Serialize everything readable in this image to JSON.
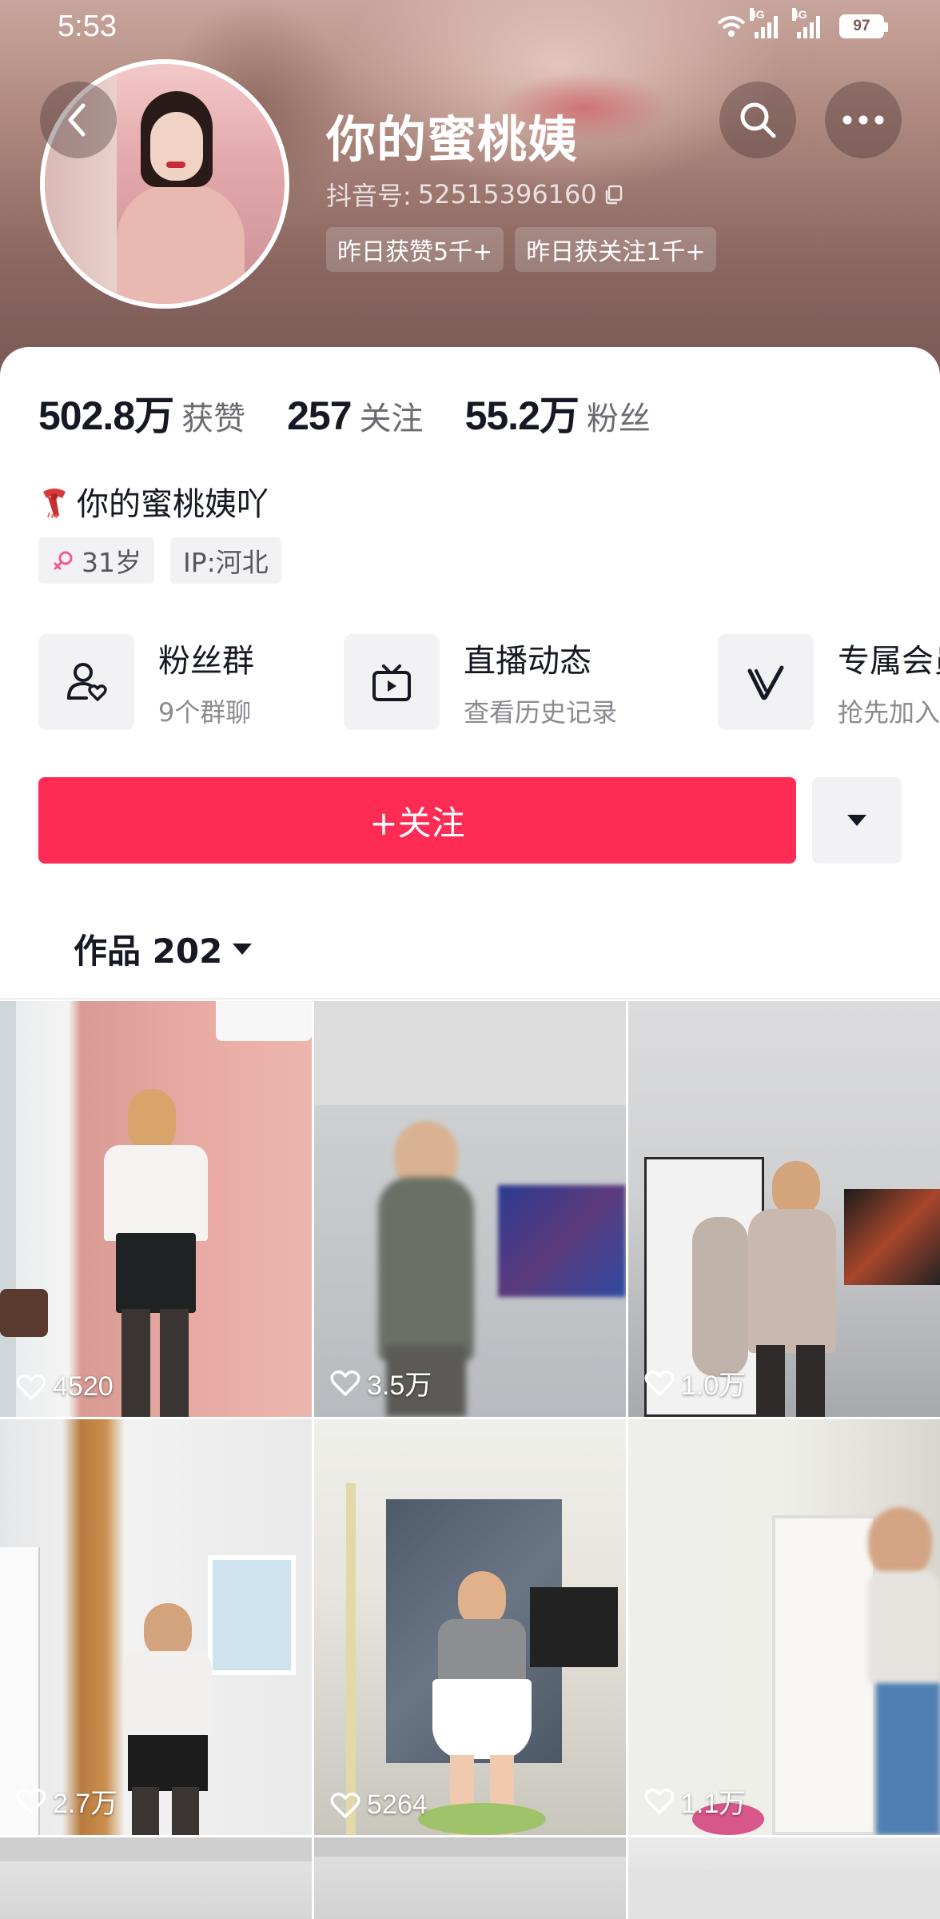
{
  "status_bar": {
    "time": "5:53",
    "battery": "97",
    "network": "4G"
  },
  "header": {
    "name": "你的蜜桃姨",
    "douyin_id_label": "抖音号:",
    "douyin_id": "52515396160",
    "tags": [
      "昨日获赞5千+",
      "昨日获关注1千+"
    ]
  },
  "stats": [
    {
      "value": "502.8万",
      "label": "获赞"
    },
    {
      "value": "257",
      "label": "关注"
    },
    {
      "value": "55.2万",
      "label": "粉丝"
    }
  ],
  "bio": "你的蜜桃姨吖",
  "profile_tags": {
    "age": "31岁",
    "ip": "IP:河北"
  },
  "features": [
    {
      "title": "粉丝群",
      "subtitle": "9个群聊",
      "icon": "fans-group-icon"
    },
    {
      "title": "直播动态",
      "subtitle": "查看历史记录",
      "icon": "live-tv-icon"
    },
    {
      "title": "专属会员",
      "subtitle": "抢先加入",
      "icon": "vip-v-icon"
    }
  ],
  "actions": {
    "follow_label": "+关注"
  },
  "works": {
    "label": "作品 202"
  },
  "videos": [
    {
      "likes": "4520"
    },
    {
      "likes": "3.5万"
    },
    {
      "likes": "1.0万"
    },
    {
      "likes": "2.7万"
    },
    {
      "likes": "5264"
    },
    {
      "likes": "1.1万"
    }
  ],
  "colors": {
    "accent": "#fe2c55",
    "text": "#161823",
    "muted": "#6b6c73",
    "chip_bg": "#f2f2f4"
  }
}
